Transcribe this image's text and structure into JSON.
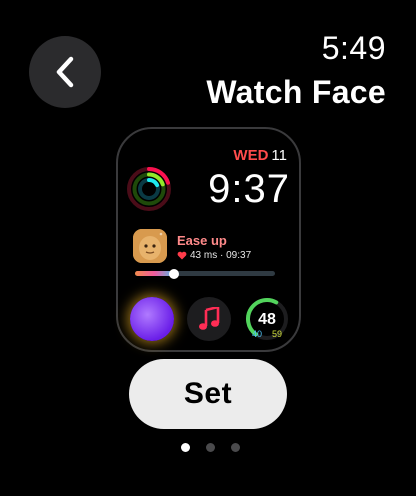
{
  "status": {
    "time": "5:49"
  },
  "header": {
    "title": "Watch Face"
  },
  "nav": {
    "back_icon": "chevron-left-icon"
  },
  "face": {
    "date_day": "WED",
    "date_num": "11",
    "clock": "9:37",
    "mindfulness": {
      "title": "Ease up",
      "heart_rate": "43 ms · 09:37",
      "progress": 0.28
    },
    "complications": {
      "siri": "siri-orb-icon",
      "music": "music-note-icon",
      "gauge": {
        "value": "48",
        "low": "40",
        "high": "59",
        "level": 0.6
      }
    }
  },
  "actions": {
    "set_label": "Set"
  },
  "pager": {
    "count": 3,
    "active": 0
  },
  "colors": {
    "accent_red": "#ff4b4b",
    "button_bg": "#ececec"
  }
}
